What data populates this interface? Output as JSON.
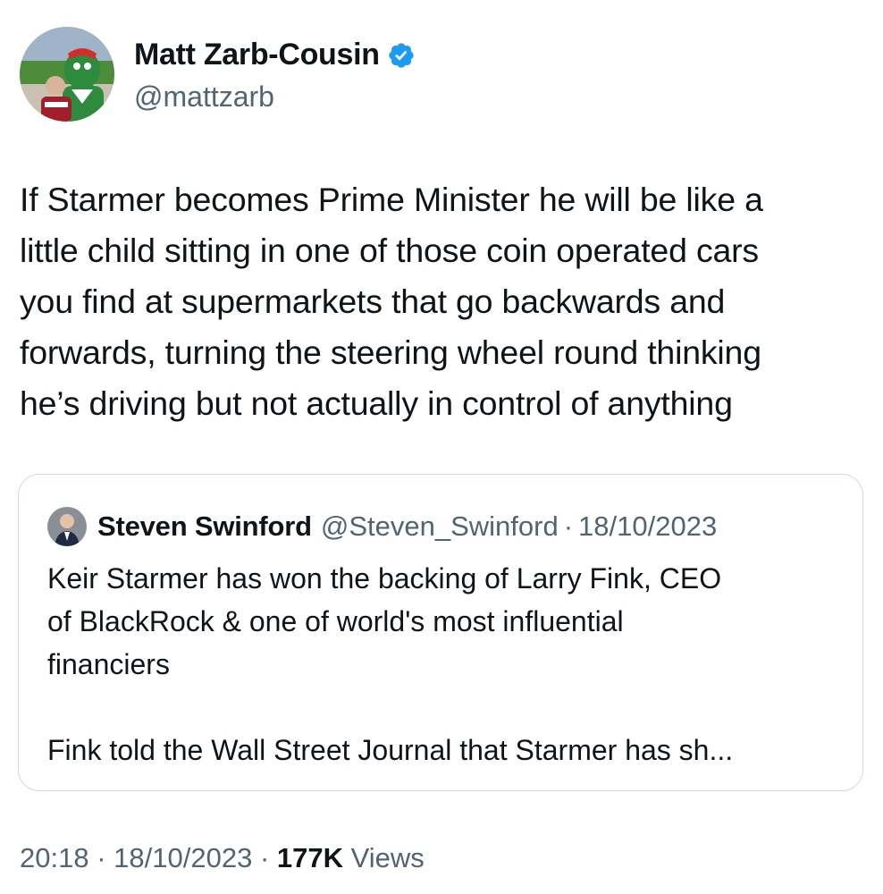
{
  "author": {
    "name": "Matt Zarb-Cousin",
    "handle": "@mattzarb",
    "verified": true,
    "verified_icon": "verified-badge-icon",
    "accent_color": "#1d9bf0"
  },
  "tweet": {
    "text": "If Starmer becomes Prime Minister he will be like a\nlittle child sitting in one of those coin operated cars\nyou find at supermarkets that go backwards and\nforwards, turning the steering wheel round thinking\nhe’s driving but not actually in control of anything"
  },
  "quoted_tweet": {
    "author_name": "Steven Swinford",
    "handle": "@Steven_Swinford",
    "separator": "·",
    "date": "18/10/2023",
    "text": "Keir Starmer has won the backing of Larry Fink, CEO\nof BlackRock & one of world's most influential\nfinanciers\n\nFink told the Wall Street Journal that Starmer has sh..."
  },
  "footer": {
    "time": "20:18",
    "separator": "·",
    "date": "18/10/2023",
    "views_count": "177K",
    "views_label": "Views"
  }
}
